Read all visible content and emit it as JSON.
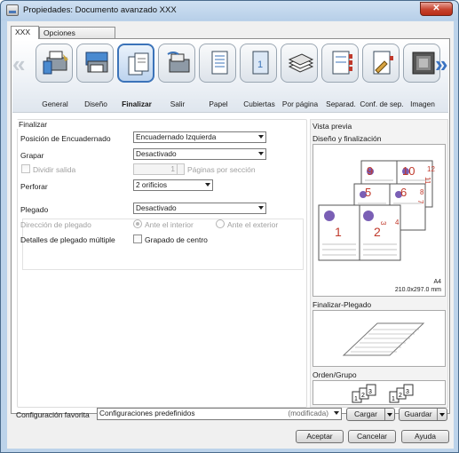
{
  "window": {
    "title": "Propiedades: Documento avanzado XXX",
    "close_label": "✕"
  },
  "tabs": [
    {
      "label": "XXX",
      "active": true
    },
    {
      "label": "Opciones avanzadas",
      "active": false
    }
  ],
  "iconbar": {
    "left_arrow": "«",
    "right_arrow": "»",
    "items": [
      {
        "label": "General",
        "icon": "general-icon",
        "selected": false
      },
      {
        "label": "Diseño",
        "icon": "layout-icon",
        "selected": false
      },
      {
        "label": "Finalizar",
        "icon": "finishing-icon",
        "selected": true
      },
      {
        "label": "Salir",
        "icon": "output-icon",
        "selected": false
      },
      {
        "label": "Papel",
        "icon": "paper-icon",
        "selected": false
      },
      {
        "label": "Cubiertas",
        "icon": "covers-icon",
        "selected": false
      },
      {
        "label": "Por página",
        "icon": "per-page-icon",
        "selected": false
      },
      {
        "label": "Separad.",
        "icon": "separators-icon",
        "selected": false
      },
      {
        "label": "Conf. de sep.",
        "icon": "separator-settings-icon",
        "selected": false
      },
      {
        "label": "Imagen",
        "icon": "image-icon",
        "selected": false
      }
    ]
  },
  "finalizar": {
    "group_title": "Finalizar",
    "binding_position": {
      "label": "Posición de Encuadernado",
      "value": "Encuadernado Izquierda"
    },
    "staple": {
      "label": "Grapar",
      "value": "Desactivado"
    },
    "split_output": {
      "label": "Dividir salida",
      "count": "1",
      "suffix": "Páginas por sección"
    },
    "punch": {
      "label": "Perforar",
      "value": "2 orificios"
    },
    "fold": {
      "label": "Plegado",
      "value": "Desactivado"
    },
    "fold_direction": {
      "label": "Dirección de plegado",
      "inside": "Ante el interior",
      "outside": "Ante el exterior"
    },
    "multi_fold": {
      "label": "Detalles de plegado múltiple",
      "checkbox": "Grapado de centro"
    }
  },
  "preview": {
    "title": "Vista previa",
    "layout_title": "Diseño y finalización",
    "page_numbers": [
      "1",
      "2",
      "3",
      "4",
      "5",
      "6",
      "7",
      "8",
      "9",
      "10",
      "11",
      "12"
    ],
    "paper_size": "A4",
    "paper_dims": "210.0x297.0 mm",
    "fold_title": "Finalizar-Plegado",
    "order_title": "Orden/Grupo",
    "order_digits": [
      "1",
      "2",
      "3",
      "1",
      "2",
      "3"
    ]
  },
  "favorites": {
    "label": "Configuración favorita",
    "value": "Configuraciones predefinidos",
    "modified": "(modificada)",
    "load_label": "Cargar",
    "save_label": "Guardar"
  },
  "footer": {
    "ok_label": "Aceptar",
    "cancel_label": "Cancelar",
    "help_label": "Ayuda"
  },
  "colors": {
    "accent": "#3b73b9",
    "page_number": "#c0392b",
    "titlebar": "#bcd3ea"
  }
}
